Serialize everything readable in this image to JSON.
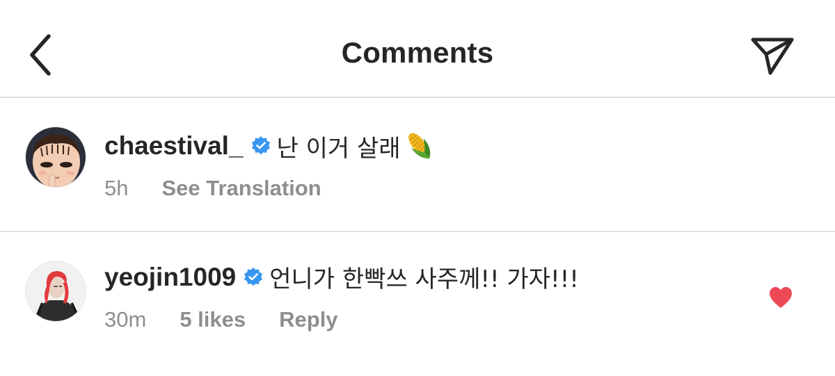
{
  "header": {
    "title": "Comments",
    "back_icon": "chevron-left-icon",
    "send_icon": "paper-plane-icon"
  },
  "comments": [
    {
      "username": "chaestival_",
      "verified": true,
      "text": "난 이거 살래",
      "emoji": "corn",
      "time": "5h",
      "action": "See Translation"
    },
    {
      "username": "yeojin1009",
      "verified": true,
      "text": "언니가 한빡쓰 사주께!! 가자!!!",
      "time": "30m",
      "likes": "5 likes",
      "reply": "Reply",
      "liked": true
    }
  ],
  "colors": {
    "text": "#262626",
    "meta": "#8e8e8e",
    "divider": "#e2e2e2",
    "verified": "#3897f0",
    "heart": "#ed4956"
  }
}
